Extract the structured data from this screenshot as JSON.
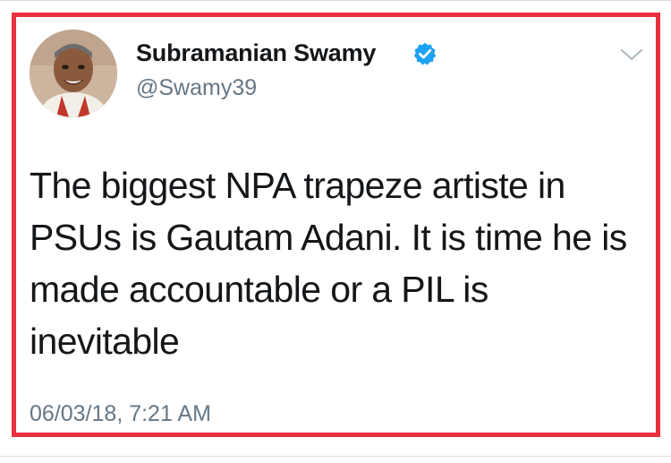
{
  "tweet": {
    "display_name": "Subramanian Swamy",
    "handle": "@Swamy39",
    "verified": true,
    "text": "The biggest NPA trapeze artiste in\nPSUs is Gautam Adani. It is time he is\nmade accountable or a PIL is\ninevitable",
    "timestamp": "06/03/18, 7:21 AM"
  },
  "icons": {
    "verified": "verified-badge-icon",
    "menu": "chevron-down-icon"
  },
  "colors": {
    "highlight_border": "#e8303f",
    "verified_badge": "#1da1f2",
    "secondary_text": "#657786",
    "primary_text": "#14171a"
  }
}
